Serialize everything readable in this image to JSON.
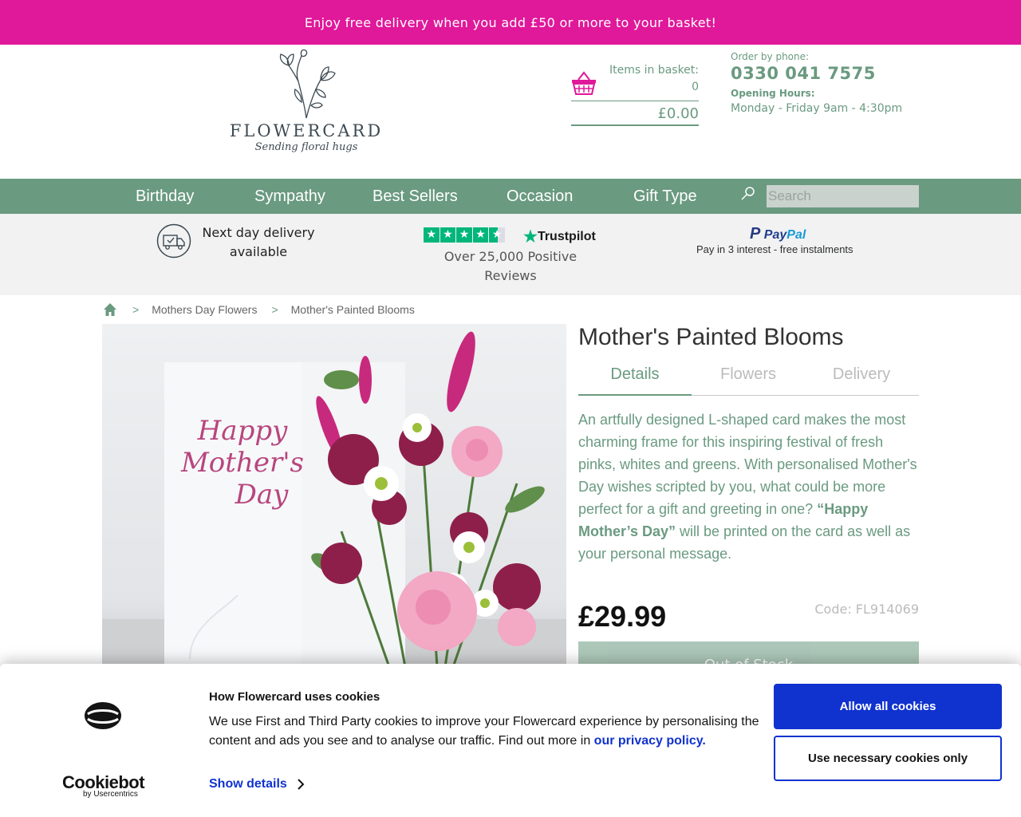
{
  "promo": {
    "text": "Enjoy free delivery when you add £50 or more to your basket!"
  },
  "header": {
    "logo": {
      "name": "FLOWERCARD",
      "tagline": "Sending floral hugs"
    },
    "basket": {
      "label": "Items in basket:",
      "count": "0",
      "total": "£0.00",
      "icon": "basket-icon"
    },
    "phone": {
      "label": "Order by phone:",
      "number": "0330 041 7575",
      "hours_label": "Opening Hours:",
      "hours": "Monday - Friday 9am - 4:30pm"
    }
  },
  "nav": {
    "items": [
      {
        "label": "Birthday"
      },
      {
        "label": "Sympathy"
      },
      {
        "label": "Best Sellers"
      },
      {
        "label": "Occasion"
      },
      {
        "label": "Gift Type"
      }
    ],
    "search": {
      "placeholder": "Search",
      "icon": "search-icon"
    }
  },
  "trust": {
    "delivery": {
      "text": "Next day delivery available",
      "icon": "delivery-truck-icon"
    },
    "trustpilot": {
      "brand": "Trustpilot",
      "text": "Over 25,000 Positive Reviews",
      "rating_stars": 4.5
    },
    "paypal": {
      "brand_pay": "Pay",
      "brand_pal": "Pal",
      "text": "Pay in 3 interest - free instalments"
    }
  },
  "breadcrumb": {
    "home_icon": "home-icon",
    "items": [
      {
        "label": "Mothers Day Flowers"
      },
      {
        "label": "Mother's Painted Blooms"
      }
    ]
  },
  "product": {
    "title": "Mother's Painted Blooms",
    "tabs": [
      {
        "label": "Details"
      },
      {
        "label": "Flowers"
      },
      {
        "label": "Delivery"
      }
    ],
    "description_before": "An artfully designed L-shaped card makes the most charming frame for this inspiring festival of fresh pinks, whites and greens. With personalised Mother's Day wishes scripted by you, what could be more perfect for a gift and greeting in one? ",
    "description_bold": "“Happy Mother’s Day”",
    "description_after": " will be printed on the card as well as your personal message.",
    "price": "£29.99",
    "code": "Code: FL914069",
    "stock_button": "Out of Stock",
    "card_text": [
      "Happy",
      "Mother's",
      "Day"
    ]
  },
  "cookies": {
    "brand": "Cookiebot",
    "brand_sub": "by Usercentrics",
    "title": "How Flowercard uses cookies",
    "body": "We use First and Third Party cookies to improve your Flowercard experience by personalising the content and ads you see and to analyse our traffic. Find out more in ",
    "link": "our privacy policy.",
    "details": "Show details",
    "allow_all": "Allow all cookies",
    "necessary_only": "Use necessary cookies only"
  },
  "colors": {
    "promo": "#e0189a",
    "brand_green": "#6a9a80",
    "cookie_blue": "#1032cf"
  }
}
